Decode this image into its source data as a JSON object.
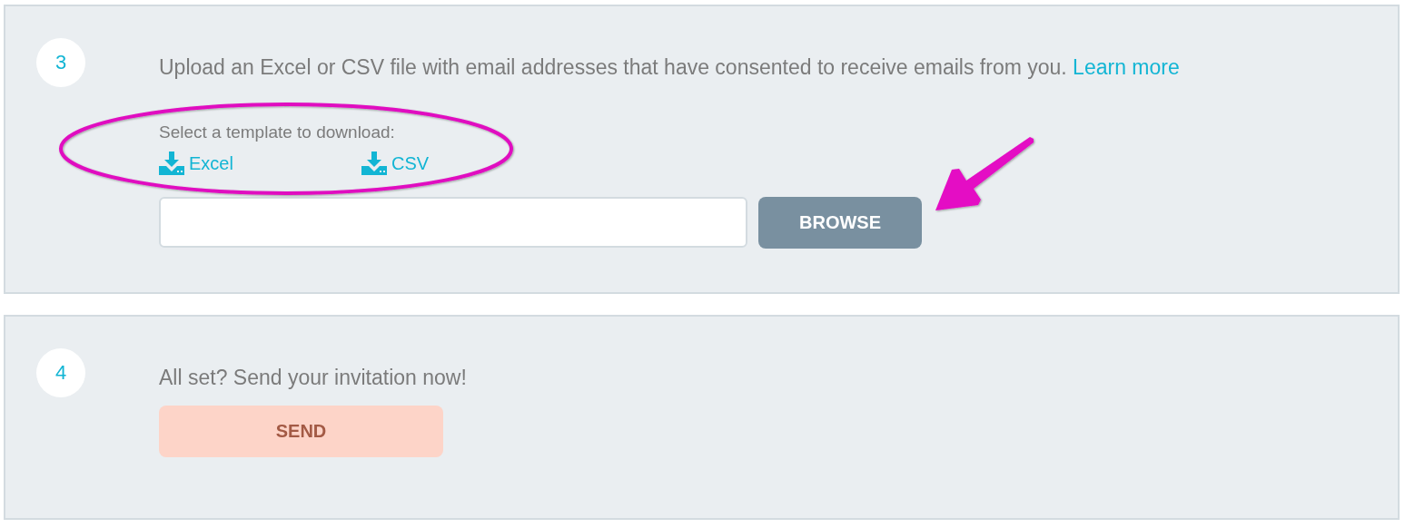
{
  "steps": [
    {
      "number": "3",
      "text": "Upload an Excel or CSV file with email addresses that have consented to receive emails from you.",
      "link": "Learn more",
      "template": {
        "label": "Select a template to download:",
        "links": [
          "Excel",
          "CSV"
        ]
      },
      "file_field": true,
      "button": {
        "label": "BROWSE",
        "disabled": false
      }
    },
    {
      "number": "4",
      "text": "All set? Send your invitation now!",
      "file_field": false,
      "button": {
        "label": "SEND",
        "disabled": true
      }
    }
  ],
  "annotations": [
    {
      "kind": "ellipse"
    },
    {
      "kind": "arrow"
    }
  ]
}
